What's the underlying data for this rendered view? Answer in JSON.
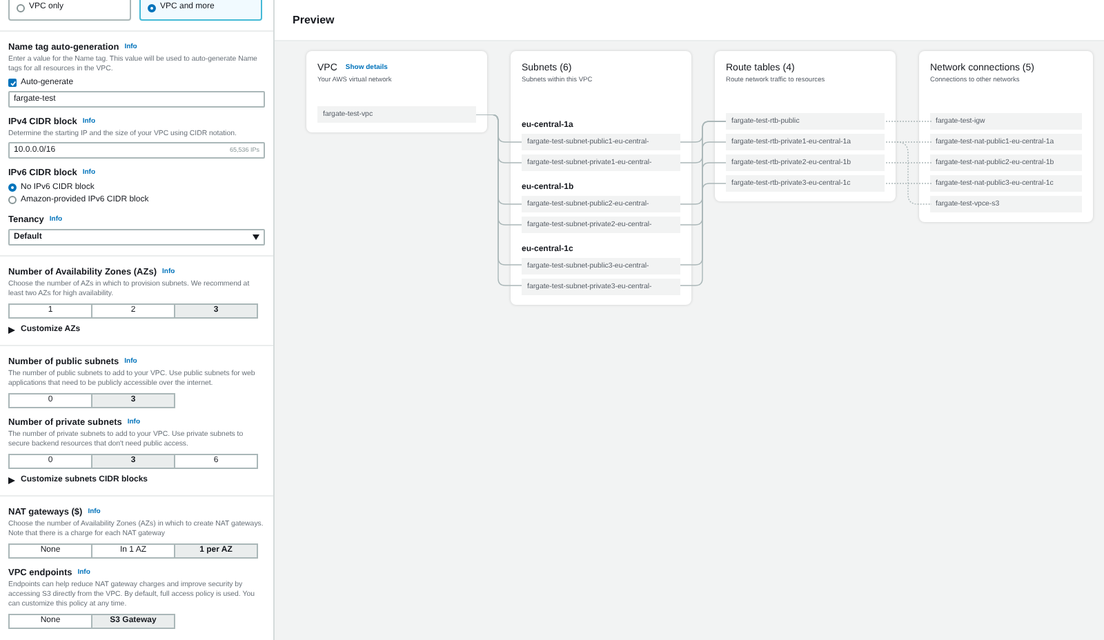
{
  "vpc_type_options": [
    {
      "label": "VPC only",
      "selected": false
    },
    {
      "label": "VPC and more",
      "selected": true
    }
  ],
  "groups": [
    [
      {
        "kind": "text",
        "label": "Name tag auto-generation",
        "info": "Info",
        "description": "Enter a value for the Name tag. This value will be used to auto-generate Name tags for all resources in the VPC.",
        "checkbox": {
          "label": "Auto-generate",
          "checked": true
        },
        "value": "fargate-test"
      },
      {
        "kind": "text",
        "label": "IPv4 CIDR block",
        "info": "Info",
        "description": "Determine the starting IP and the size of your VPC using CIDR notation.",
        "value": "10.0.0.0/16",
        "suffix": "65,536 IPs"
      },
      {
        "kind": "radio",
        "label": "IPv6 CIDR block",
        "info": "Info",
        "options": [
          {
            "label": "No IPv6 CIDR block",
            "selected": true
          },
          {
            "label": "Amazon-provided IPv6 CIDR block",
            "selected": false
          }
        ]
      },
      {
        "kind": "select",
        "label": "Tenancy",
        "info": "Info",
        "value": "Default"
      }
    ],
    [
      {
        "kind": "segmented",
        "label": "Number of Availability Zones (AZs)",
        "info": "Info",
        "description": "Choose the number of AZs in which to provision subnets. We recommend at least two AZs for high availability.",
        "options": [
          {
            "label": "1",
            "selected": false
          },
          {
            "label": "2",
            "selected": false
          },
          {
            "label": "3",
            "selected": true
          }
        ],
        "expander": {
          "label": "Customize AZs",
          "expanded": false
        }
      }
    ],
    [
      {
        "kind": "segmented",
        "label": "Number of public subnets",
        "info": "Info",
        "description": "The number of public subnets to add to your VPC. Use public subnets for web applications that need to be publicly accessible over the internet.",
        "options": [
          {
            "label": "0",
            "selected": false
          },
          {
            "label": "3",
            "selected": true
          }
        ]
      },
      {
        "kind": "segmented",
        "label": "Number of private subnets",
        "info": "Info",
        "description": "The number of private subnets to add to your VPC. Use private subnets to secure backend resources that don't need public access.",
        "options": [
          {
            "label": "0",
            "selected": false
          },
          {
            "label": "3",
            "selected": true
          },
          {
            "label": "6",
            "selected": false
          }
        ],
        "expander": {
          "label": "Customize subnets CIDR blocks",
          "expanded": false
        }
      }
    ],
    [
      {
        "kind": "segmented",
        "label": "NAT gateways ($)",
        "info": "Info",
        "description": "Choose the number of Availability Zones (AZs) in which to create NAT gateways. Note that there is a charge for each NAT gateway",
        "options": [
          {
            "label": "None",
            "selected": false
          },
          {
            "label": "In 1 AZ",
            "selected": false
          },
          {
            "label": "1 per AZ",
            "selected": true
          }
        ]
      },
      {
        "kind": "segmented",
        "label": "VPC endpoints",
        "info": "Info",
        "description": "Endpoints can help reduce NAT gateway charges and improve security by accessing S3 directly from the VPC. By default, full access policy is used. You can customize this policy at any time.",
        "options": [
          {
            "label": "None",
            "selected": false
          },
          {
            "label": "S3 Gateway",
            "selected": true
          }
        ]
      }
    ]
  ],
  "preview": {
    "title": "Preview",
    "cards": [
      {
        "title": "VPC",
        "link": "Show details",
        "subtitle": "Your AWS virtual network",
        "groups": [
          {
            "items": [
              "fargate-test-vpc"
            ]
          }
        ]
      },
      {
        "title": "Subnets (6)",
        "subtitle": "Subnets within this VPC",
        "groups": [
          {
            "heading": "eu-central-1a",
            "items": [
              "fargate-test-subnet-public1-eu-central-",
              "fargate-test-subnet-private1-eu-central-"
            ]
          },
          {
            "heading": "eu-central-1b",
            "items": [
              "fargate-test-subnet-public2-eu-central-",
              "fargate-test-subnet-private2-eu-central-"
            ]
          },
          {
            "heading": "eu-central-1c",
            "items": [
              "fargate-test-subnet-public3-eu-central-",
              "fargate-test-subnet-private3-eu-central-"
            ]
          }
        ]
      },
      {
        "title": "Route tables (4)",
        "subtitle": "Route network traffic to resources",
        "groups": [
          {
            "items": [
              "fargate-test-rtb-public",
              "fargate-test-rtb-private1-eu-central-1a",
              "fargate-test-rtb-private2-eu-central-1b",
              "fargate-test-rtb-private3-eu-central-1c"
            ]
          }
        ]
      },
      {
        "title": "Network connections (5)",
        "subtitle": "Connections to other networks",
        "groups": [
          {
            "items": [
              "fargate-test-igw",
              "fargate-test-nat-public1-eu-central-1a",
              "fargate-test-nat-public2-eu-central-1b",
              "fargate-test-nat-public3-eu-central-1c",
              "fargate-test-vpce-s3"
            ]
          }
        ]
      }
    ]
  }
}
